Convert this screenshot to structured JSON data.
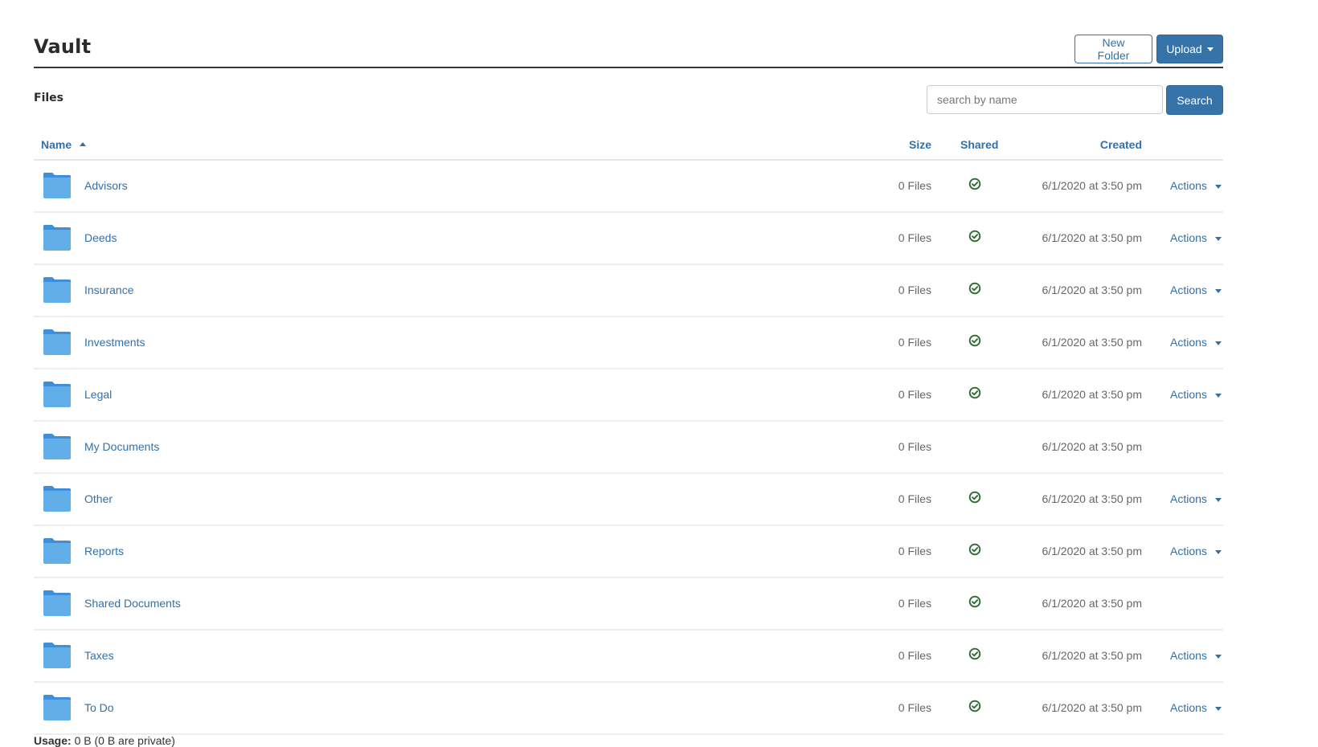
{
  "header": {
    "title": "Vault",
    "new_folder_label": "New Folder",
    "upload_label": "Upload"
  },
  "files_section": {
    "label": "Files",
    "search": {
      "value": "",
      "placeholder": "search by name"
    },
    "search_button_label": "Search"
  },
  "table": {
    "columns": {
      "name": "Name",
      "size": "Size",
      "shared": "Shared",
      "created": "Created"
    },
    "sort": {
      "column": "name",
      "direction": "ascending"
    },
    "rows": [
      {
        "name": "Advisors",
        "size": "0 Files",
        "shared": true,
        "created": "6/1/2020 at 3:50 pm",
        "actions": "Actions"
      },
      {
        "name": "Deeds",
        "size": "0 Files",
        "shared": true,
        "created": "6/1/2020 at 3:50 pm",
        "actions": "Actions"
      },
      {
        "name": "Insurance",
        "size": "0 Files",
        "shared": true,
        "created": "6/1/2020 at 3:50 pm",
        "actions": "Actions"
      },
      {
        "name": "Investments",
        "size": "0 Files",
        "shared": true,
        "created": "6/1/2020 at 3:50 pm",
        "actions": "Actions"
      },
      {
        "name": "Legal",
        "size": "0 Files",
        "shared": true,
        "created": "6/1/2020 at 3:50 pm",
        "actions": "Actions"
      },
      {
        "name": "My Documents",
        "size": "0 Files",
        "shared": false,
        "created": "6/1/2020 at 3:50 pm",
        "actions": null
      },
      {
        "name": "Other",
        "size": "0 Files",
        "shared": true,
        "created": "6/1/2020 at 3:50 pm",
        "actions": "Actions"
      },
      {
        "name": "Reports",
        "size": "0 Files",
        "shared": true,
        "created": "6/1/2020 at 3:50 pm",
        "actions": "Actions"
      },
      {
        "name": "Shared Documents",
        "size": "0 Files",
        "shared": true,
        "created": "6/1/2020 at 3:50 pm",
        "actions": null
      },
      {
        "name": "Taxes",
        "size": "0 Files",
        "shared": true,
        "created": "6/1/2020 at 3:50 pm",
        "actions": "Actions"
      },
      {
        "name": "To Do",
        "size": "0 Files",
        "shared": true,
        "created": "6/1/2020 at 3:50 pm",
        "actions": "Actions"
      }
    ]
  },
  "footer": {
    "usage_label": "Usage:",
    "usage_value": "0 B (0 B are private)"
  },
  "icons": {
    "row_icon": "folder-icon",
    "shared_icon": "check-circle-icon",
    "sort_icon": "caret-up-icon",
    "dropdown_icon": "caret-down-icon"
  },
  "colors": {
    "primary": "#3573a9",
    "link": "#3370a8",
    "folder": "#62aee8",
    "folder_tab": "#3d8fdb",
    "shared_check": "#2e6b34",
    "muted_text": "#666666"
  }
}
